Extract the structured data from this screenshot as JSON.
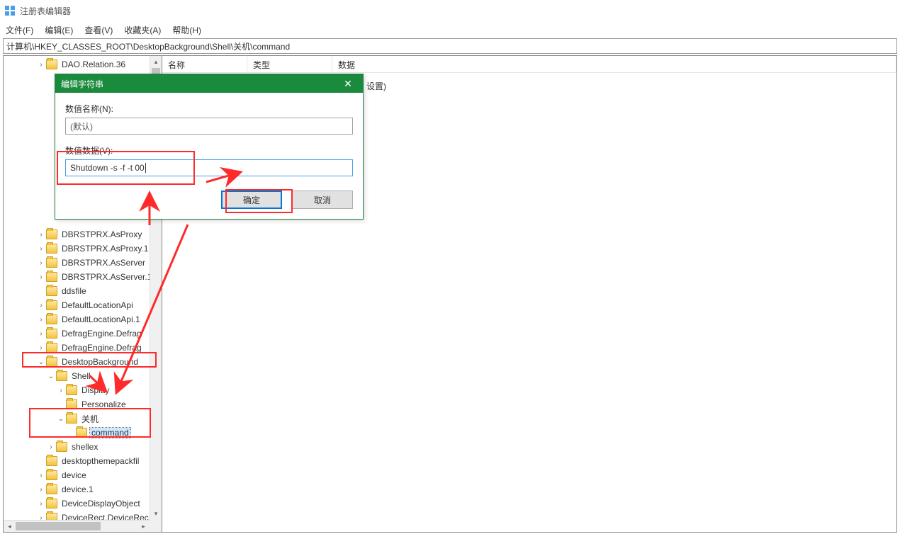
{
  "window": {
    "title": "注册表编辑器"
  },
  "menu": {
    "file": "文件(F)",
    "edit": "编辑(E)",
    "view": "查看(V)",
    "favorites": "收藏夹(A)",
    "help": "帮助(H)"
  },
  "address": "计算机\\HKEY_CLASSES_ROOT\\DesktopBackground\\Shell\\关机\\command",
  "tree": [
    {
      "indent": 3,
      "caret": "closed",
      "label": "DAO.Relation.36"
    },
    {
      "indent": 3,
      "caret": "none",
      "label": ""
    },
    {
      "indent": 3,
      "caret": "none",
      "label": ""
    },
    {
      "indent": 3,
      "caret": "none",
      "label": ""
    },
    {
      "indent": 3,
      "caret": "none",
      "label": ""
    },
    {
      "indent": 3,
      "caret": "none",
      "label": ""
    },
    {
      "indent": 3,
      "caret": "none",
      "label": ""
    },
    {
      "indent": 3,
      "caret": "none",
      "label": ""
    },
    {
      "indent": 3,
      "caret": "none",
      "label": ""
    },
    {
      "indent": 3,
      "caret": "none",
      "label": ""
    },
    {
      "indent": 3,
      "caret": "none",
      "label": ""
    },
    {
      "indent": 3,
      "caret": "none",
      "label": ""
    },
    {
      "indent": 3,
      "caret": "closed",
      "label": "DBRSTPRX.AsProxy"
    },
    {
      "indent": 3,
      "caret": "closed",
      "label": "DBRSTPRX.AsProxy.1"
    },
    {
      "indent": 3,
      "caret": "closed",
      "label": "DBRSTPRX.AsServer"
    },
    {
      "indent": 3,
      "caret": "closed",
      "label": "DBRSTPRX.AsServer.1"
    },
    {
      "indent": 3,
      "caret": "none",
      "label": "ddsfile"
    },
    {
      "indent": 3,
      "caret": "closed",
      "label": "DefaultLocationApi"
    },
    {
      "indent": 3,
      "caret": "closed",
      "label": "DefaultLocationApi.1"
    },
    {
      "indent": 3,
      "caret": "closed",
      "label": "DefragEngine.Defrag"
    },
    {
      "indent": 3,
      "caret": "closed",
      "label": "DefragEngine.Defrag"
    },
    {
      "indent": 3,
      "caret": "open",
      "label": "DesktopBackground"
    },
    {
      "indent": 4,
      "caret": "open",
      "label": "Shell"
    },
    {
      "indent": 5,
      "caret": "closed",
      "label": "Display"
    },
    {
      "indent": 5,
      "caret": "none",
      "label": "Personalize"
    },
    {
      "indent": 5,
      "caret": "open",
      "label": "关机"
    },
    {
      "indent": 6,
      "caret": "none",
      "label": "command",
      "selected": true
    },
    {
      "indent": 4,
      "caret": "closed",
      "label": "shellex"
    },
    {
      "indent": 3,
      "caret": "none",
      "label": "desktopthemepackfil"
    },
    {
      "indent": 3,
      "caret": "closed",
      "label": "device"
    },
    {
      "indent": 3,
      "caret": "closed",
      "label": "device.1"
    },
    {
      "indent": 3,
      "caret": "closed",
      "label": "DeviceDisplayObject"
    },
    {
      "indent": 3,
      "caret": "closed",
      "label": "DeviceRect.DeviceRec"
    }
  ],
  "list": {
    "columns": {
      "name": "名称",
      "type": "类型",
      "data": "数据"
    },
    "row": {
      "data_suffix": "设置)"
    }
  },
  "dialog": {
    "title": "编辑字符串",
    "name_label": "数值名称(N):",
    "name_value": "(默认)",
    "data_label": "数值数据(V):",
    "data_value": "Shutdown -s -f -t 00",
    "ok": "确定",
    "cancel": "取消",
    "close": "✕"
  }
}
